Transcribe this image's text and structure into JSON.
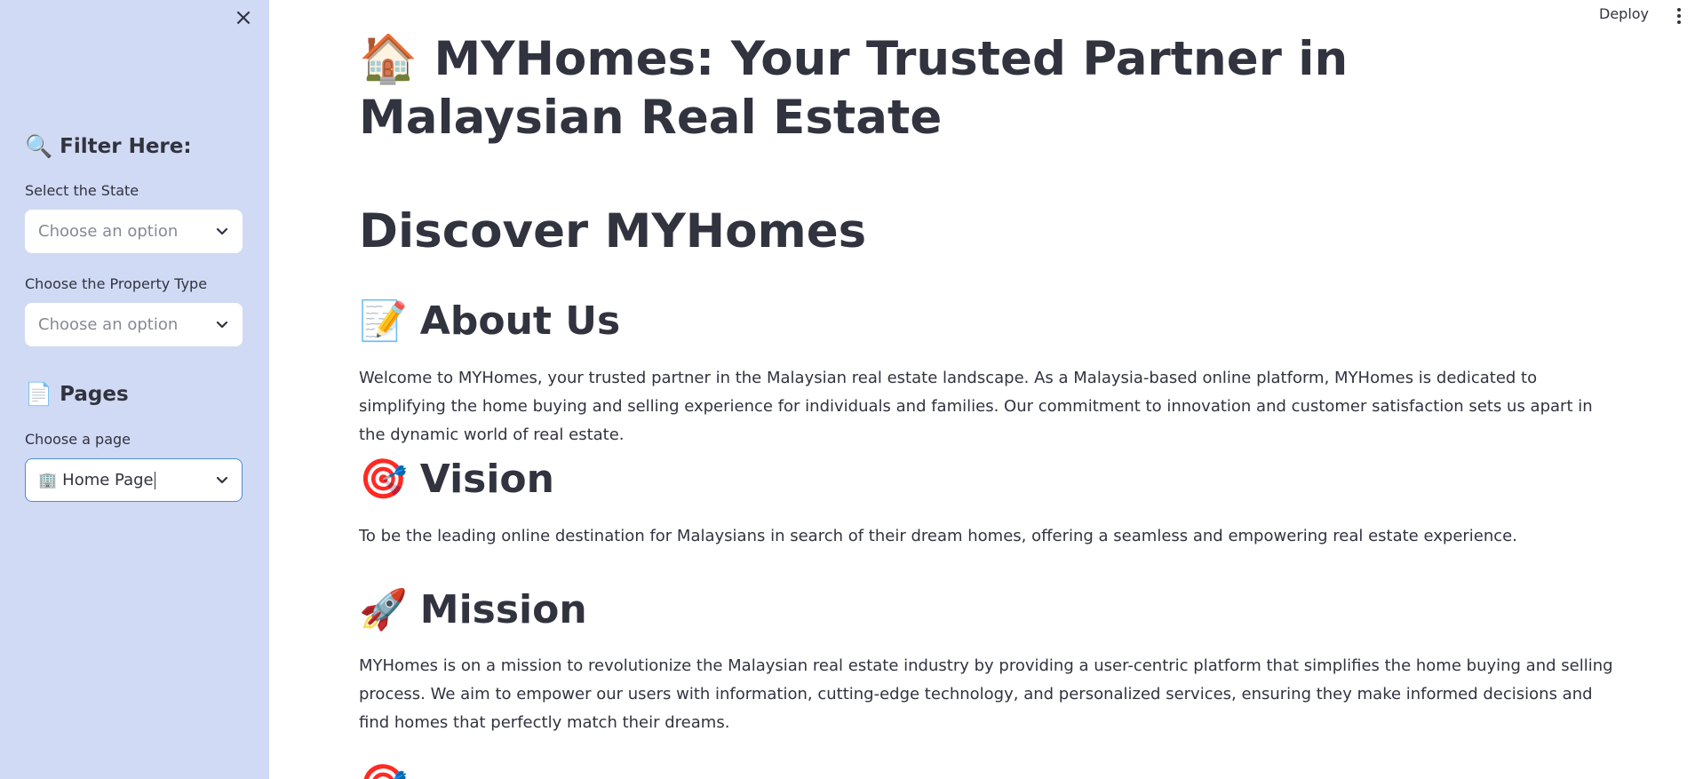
{
  "sidebar": {
    "close_icon": "×",
    "filter_heading_icon": "🔍",
    "filter_heading": "Filter Here:",
    "state_label": "Select the State",
    "state_placeholder": "Choose an option",
    "type_label": "Choose the Property Type",
    "type_placeholder": "Choose an option",
    "pages_heading_icon": "📄",
    "pages_heading": "Pages",
    "page_label": "Choose a page",
    "page_value_icon": "🏢",
    "page_value": "Home Page"
  },
  "topbar": {
    "deploy_label": "Deploy"
  },
  "main": {
    "title_icon": "🏠",
    "title": "MYHomes: Your Trusted Partner in Malaysian Real Estate",
    "discover": "Discover MYHomes",
    "about_icon": "📝",
    "about_heading": "About Us",
    "about_text": "Welcome to MYHomes, your trusted partner in the Malaysian real estate landscape. As a Malaysia-based online platform, MYHomes is dedicated to simplifying the home buying and selling experience for individuals and families. Our commitment to innovation and customer satisfaction sets us apart in the dynamic world of real estate.",
    "vision_icon": "🎯",
    "vision_heading": "Vision",
    "vision_text": "To be the leading online destination for Malaysians in search of their dream homes, offering a seamless and empowering real estate experience.",
    "mission_icon": "🚀",
    "mission_heading": "Mission",
    "mission_text": "MYHomes is on a mission to revolutionize the Malaysian real estate industry by providing a user-centric platform that simplifies the home buying and selling process. We aim to empower our users with information, cutting-edge technology, and personalized services, ensuring they make informed decisions and find homes that perfectly match their dreams.",
    "next_section_icon": "🎯"
  },
  "colors": {
    "sidebar_bg": "#D0DAF4",
    "text": "#31333F",
    "placeholder": "#868a94",
    "focus_border": "#4a8fd6"
  }
}
